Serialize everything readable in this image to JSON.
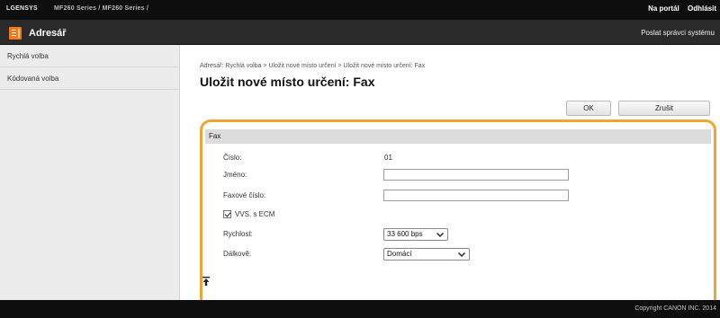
{
  "topbar": {
    "device_name": "LGENSYS",
    "device_model": "MF260 Series / MF260 Series /",
    "portal_link": "Na portál",
    "logout_link": "Odhlásit"
  },
  "header": {
    "app_title": "Adresář",
    "sysadmin_link": "Poslat správci systému"
  },
  "sidebar": {
    "items": [
      {
        "label": "Rychlá volba"
      },
      {
        "label": "Kódovaná volba"
      }
    ]
  },
  "main": {
    "breadcrumb": "Adresář: Rychlá volba > Uložit nové místo určení > Uložit nové místo určení: Fax",
    "title": "Uložit nové místo určení: Fax",
    "ok_label": "OK",
    "cancel_label": "Zrušit"
  },
  "fax_section": {
    "header": "Fax",
    "number_label": "Číslo:",
    "number_value": "01",
    "name_label": "Jméno:",
    "name_value": "",
    "fax_number_label": "Faxové číslo:",
    "fax_number_value": "",
    "ecm_label": "VVS. s ECM",
    "ecm_checked": true,
    "speed_label": "Rychlost:",
    "speed_value": "33 600 bps",
    "distance_label": "Dálkově:",
    "distance_value": "Domácí"
  },
  "footer": {
    "copyright": "Copyright CANON INC. 2014"
  },
  "colors": {
    "highlight": "#f0a432",
    "logo": "#ee7a1b",
    "topbar": "#0e0e0e",
    "header": "#2a2a2a"
  },
  "icons": {
    "logo": "address-book-icon",
    "select_arrow": "chevron-down-icon",
    "back_to_top": "back-to-top-icon"
  }
}
